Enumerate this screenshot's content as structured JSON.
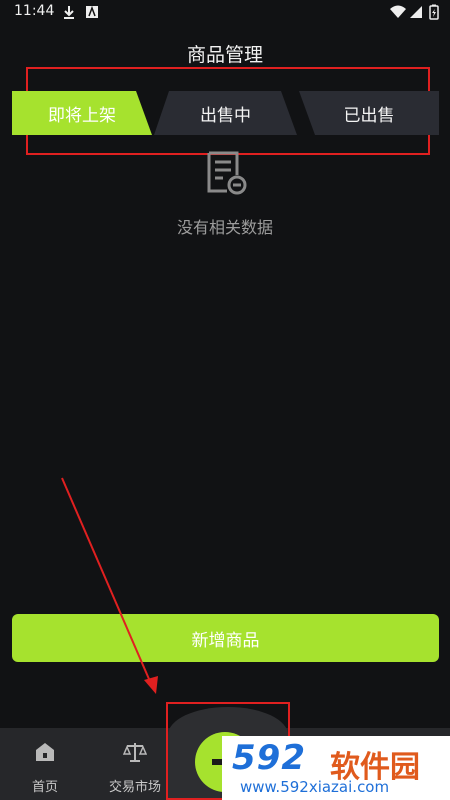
{
  "status_bar": {
    "time": "11:44"
  },
  "header": {
    "title": "商品管理"
  },
  "tabs": [
    {
      "label": "即将上架",
      "active": true
    },
    {
      "label": "出售中",
      "active": false
    },
    {
      "label": "已出售",
      "active": false
    }
  ],
  "empty_state": {
    "text": "没有相关数据",
    "icon": "document-empty-icon"
  },
  "add_button": {
    "label": "新增商品"
  },
  "bottom_nav": [
    {
      "label": "首页",
      "icon": "home-icon"
    },
    {
      "label": "交易市场",
      "icon": "scale-icon"
    },
    {
      "label": "",
      "icon": "plus-icon"
    }
  ],
  "watermark": {
    "logo": "592",
    "name": "软件园",
    "url": "www.592xiazai.com"
  },
  "colors": {
    "accent": "#a6e22e",
    "background": "#111214",
    "tab_inactive": "#2a2c33",
    "annotation": "#e02020"
  }
}
